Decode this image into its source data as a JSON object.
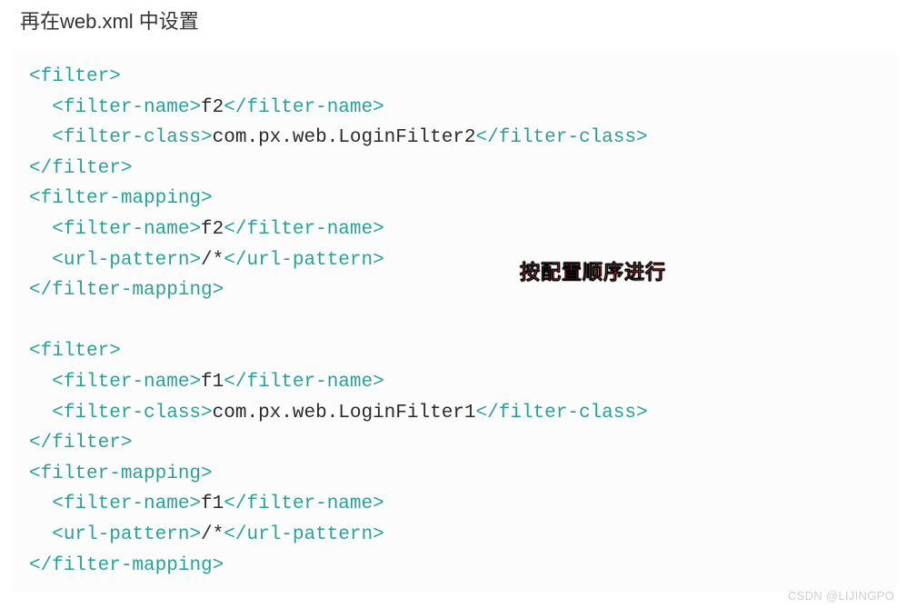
{
  "heading": "再在web.xml 中设置",
  "annotation": "按配置顺序进行",
  "watermark": "CSDN @LIJINGPO",
  "code": {
    "tags": {
      "filter_open": "filter",
      "filter_close": "filter",
      "filter_name_open": "filter-name",
      "filter_name_close": "filter-name",
      "filter_class_open": "filter-class",
      "filter_class_close": "filter-class",
      "filter_mapping_open": "filter-mapping",
      "filter_mapping_close": "filter-mapping",
      "url_pattern_open": "url-pattern",
      "url_pattern_close": "url-pattern"
    },
    "values": {
      "name1": "f2",
      "class1": "com.px.web.LoginFilter2",
      "pattern1": "/*",
      "name2": "f1",
      "class2": "com.px.web.LoginFilter1",
      "pattern2": "/*"
    }
  }
}
